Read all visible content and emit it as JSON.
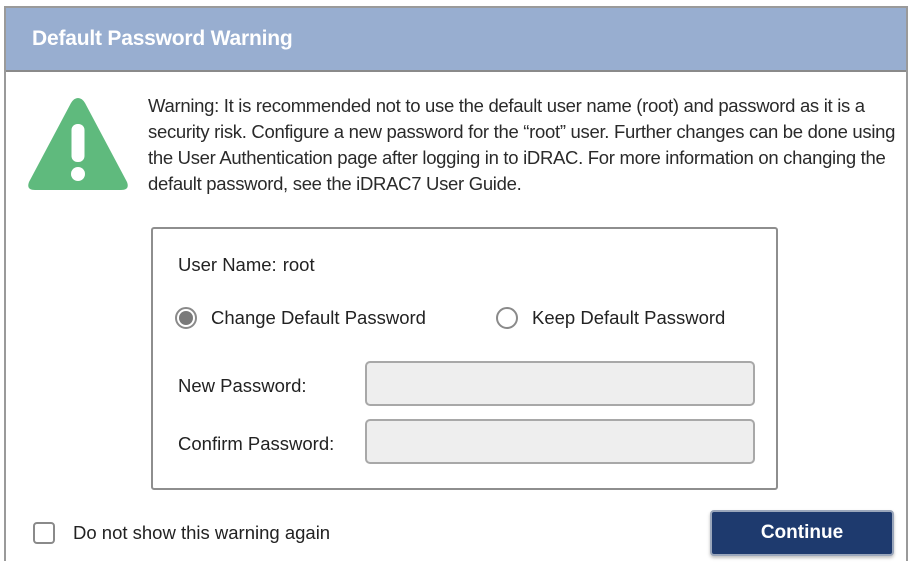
{
  "dialog": {
    "title": "Default Password Warning",
    "warning_message": "Warning: It is recommended not to use the default user name (root) and password as it is a security risk. Configure a new password for the “root” user. Further changes can be done using the User Authentication page after logging in to iDRAC. For more information on changing the default password, see the iDRAC7 User Guide.",
    "warning_icon": "warning-triangle-icon",
    "colors": {
      "titlebar": "#98aed0",
      "warning_icon": "#5fba7d",
      "continue_button": "#1e3a6e"
    }
  },
  "form": {
    "username_label": "User Name:",
    "username_value": "root",
    "options": [
      {
        "label": "Change Default Password",
        "selected": true
      },
      {
        "label": "Keep Default Password",
        "selected": false
      }
    ],
    "new_password_label": "New Password:",
    "new_password_value": "",
    "confirm_password_label": "Confirm Password:",
    "confirm_password_value": ""
  },
  "footer": {
    "dont_show_label": "Do not show this warning again",
    "dont_show_checked": false,
    "continue_label": "Continue"
  }
}
